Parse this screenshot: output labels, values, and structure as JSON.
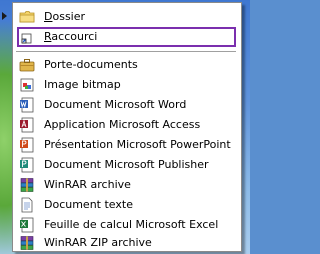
{
  "menu": {
    "items": [
      {
        "label": "Dossier",
        "icon": "folder-icon"
      },
      {
        "label": "Raccourci",
        "icon": "shortcut-icon"
      },
      {
        "label": "Porte-documents",
        "icon": "briefcase-icon"
      },
      {
        "label": "Image bitmap",
        "icon": "bitmap-icon"
      },
      {
        "label": "Document Microsoft Word",
        "icon": "word-icon"
      },
      {
        "label": "Application Microsoft Access",
        "icon": "access-icon"
      },
      {
        "label": "Présentation Microsoft PowerPoint",
        "icon": "powerpoint-icon"
      },
      {
        "label": "Document Microsoft Publisher",
        "icon": "publisher-icon"
      },
      {
        "label": "WinRAR archive",
        "icon": "winrar-icon"
      },
      {
        "label": "Document texte",
        "icon": "text-document-icon"
      },
      {
        "label": "Feuille de calcul Microsoft Excel",
        "icon": "excel-icon"
      },
      {
        "label": "WinRAR ZIP archive",
        "icon": "winrar-zip-icon"
      }
    ],
    "highlighted": "Raccourci"
  },
  "colors": {
    "highlight_border": "#7b2fae",
    "menu_bg": "#ffffff",
    "separator": "#a0a0a0"
  }
}
